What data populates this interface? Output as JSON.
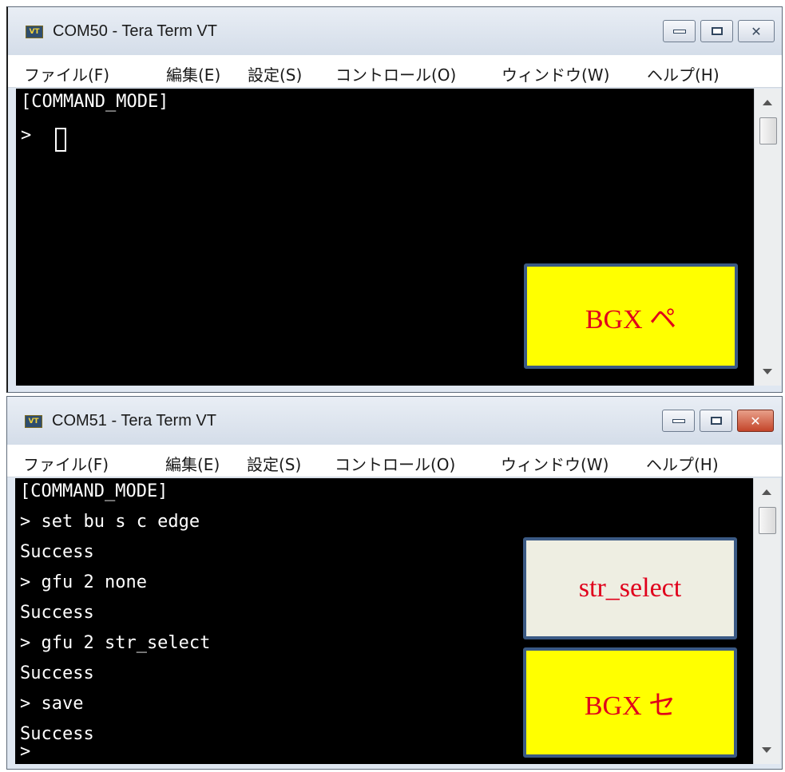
{
  "windows": [
    {
      "title": "COM50 - Tera Term VT",
      "icon_label": "VT",
      "menu": [
        "ファイル(F)",
        "編集(E)",
        "設定(S)",
        "コントロール(O)",
        "ウィンドウ(W)",
        "ヘルプ(H)"
      ],
      "terminal_lines": [
        "[COMMAND_MODE]",
        "> "
      ],
      "callouts": [
        "BGX ペ"
      ]
    },
    {
      "title": "COM51 - Tera Term VT",
      "icon_label": "VT",
      "menu": [
        "ファイル(F)",
        "編集(E)",
        "設定(S)",
        "コントロール(O)",
        "ウィンドウ(W)",
        "ヘルプ(H)"
      ],
      "terminal_lines": [
        "[COMMAND_MODE]",
        "> set bu s c edge",
        "Success",
        "> gfu 2 none",
        "Success",
        "> gfu 2 str_select",
        "Success",
        "> save",
        "Success",
        ">"
      ],
      "callouts": [
        "str_select",
        "BGX セ"
      ]
    }
  ],
  "colors": {
    "callout_text": "#e0001b",
    "callout_yellow": "#ffff00",
    "callout_cream": "#eeeee2",
    "callout_border": "#3b5a84",
    "terminal_bg": "#000000",
    "terminal_fg": "#ffffff"
  },
  "icons": {
    "app": "tera-term-icon",
    "minimize": "minimize-icon",
    "maximize": "maximize-icon",
    "close": "close-icon",
    "scroll_up": "scroll-up-arrow-icon",
    "scroll_down": "scroll-down-arrow-icon"
  }
}
